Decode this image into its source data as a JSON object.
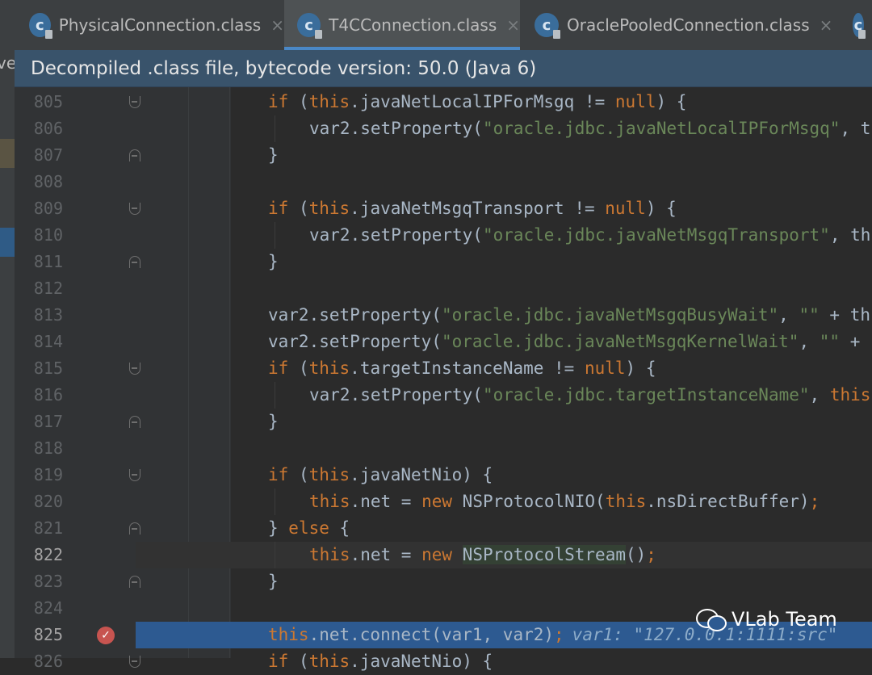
{
  "sidebar_fragment": "ve",
  "tabs": [
    {
      "label": "PhysicalConnection.class",
      "icon": "c",
      "active": false
    },
    {
      "label": "T4CConnection.class",
      "icon": "c",
      "active": true
    },
    {
      "label": "OraclePooledConnection.class",
      "icon": "c",
      "active": false
    },
    {
      "label": "",
      "icon": "c",
      "active": false
    }
  ],
  "tab_close_glyph": "×",
  "banner": "Decompiled .class file, bytecode version: 50.0 (Java 6)",
  "lines": [
    {
      "num": "805",
      "indent": 0,
      "fold": "open",
      "segs": [
        [
          "k",
          "if"
        ],
        [
          "p",
          " ("
        ],
        [
          "k",
          "this"
        ],
        [
          "p",
          ".javaNetLocalIPForMsgq != "
        ],
        [
          "k",
          "null"
        ],
        [
          "p",
          ") {"
        ]
      ]
    },
    {
      "num": "806",
      "indent": 1,
      "segs": [
        [
          "p",
          "var2.setProperty("
        ],
        [
          "s",
          "\"oracle.jdbc.javaNetLocalIPForMsgq\""
        ],
        [
          "p",
          ", t"
        ]
      ]
    },
    {
      "num": "807",
      "indent": 0,
      "fold": "close",
      "segs": [
        [
          "p",
          "}"
        ]
      ]
    },
    {
      "num": "808",
      "indent": 0,
      "segs": []
    },
    {
      "num": "809",
      "indent": 0,
      "fold": "open",
      "segs": [
        [
          "k",
          "if"
        ],
        [
          "p",
          " ("
        ],
        [
          "k",
          "this"
        ],
        [
          "p",
          ".javaNetMsgqTransport != "
        ],
        [
          "k",
          "null"
        ],
        [
          "p",
          ") {"
        ]
      ]
    },
    {
      "num": "810",
      "indent": 1,
      "segs": [
        [
          "p",
          "var2.setProperty("
        ],
        [
          "s",
          "\"oracle.jdbc.javaNetMsgqTransport\""
        ],
        [
          "p",
          ", th"
        ]
      ]
    },
    {
      "num": "811",
      "indent": 0,
      "fold": "close",
      "segs": [
        [
          "p",
          "}"
        ]
      ]
    },
    {
      "num": "812",
      "indent": 0,
      "segs": []
    },
    {
      "num": "813",
      "indent": 0,
      "segs": [
        [
          "p",
          "var2.setProperty("
        ],
        [
          "s",
          "\"oracle.jdbc.javaNetMsgqBusyWait\""
        ],
        [
          "p",
          ", "
        ],
        [
          "s",
          "\"\""
        ],
        [
          "p",
          " + th"
        ]
      ]
    },
    {
      "num": "814",
      "indent": 0,
      "segs": [
        [
          "p",
          "var2.setProperty("
        ],
        [
          "s",
          "\"oracle.jdbc.javaNetMsgqKernelWait\""
        ],
        [
          "p",
          ", "
        ],
        [
          "s",
          "\"\""
        ],
        [
          "p",
          " + "
        ]
      ]
    },
    {
      "num": "815",
      "indent": 0,
      "fold": "open",
      "segs": [
        [
          "k",
          "if"
        ],
        [
          "p",
          " ("
        ],
        [
          "k",
          "this"
        ],
        [
          "p",
          ".targetInstanceName != "
        ],
        [
          "k",
          "null"
        ],
        [
          "p",
          ") {"
        ]
      ]
    },
    {
      "num": "816",
      "indent": 1,
      "segs": [
        [
          "p",
          "var2.setProperty("
        ],
        [
          "s",
          "\"oracle.jdbc.targetInstanceName\""
        ],
        [
          "p",
          ", "
        ],
        [
          "k",
          "this"
        ]
      ]
    },
    {
      "num": "817",
      "indent": 0,
      "fold": "close",
      "segs": [
        [
          "p",
          "}"
        ]
      ]
    },
    {
      "num": "818",
      "indent": 0,
      "segs": []
    },
    {
      "num": "819",
      "indent": 0,
      "fold": "open",
      "segs": [
        [
          "k",
          "if"
        ],
        [
          "p",
          " ("
        ],
        [
          "k",
          "this"
        ],
        [
          "p",
          ".javaNetNio) {"
        ]
      ]
    },
    {
      "num": "820",
      "indent": 1,
      "segs": [
        [
          "k",
          "this"
        ],
        [
          "p",
          ".net = "
        ],
        [
          "k",
          "new"
        ],
        [
          "p",
          " NSProtocolNIO("
        ],
        [
          "k",
          "this"
        ],
        [
          "p",
          ".nsDirectBuffer)"
        ],
        [
          "k",
          ";"
        ]
      ]
    },
    {
      "num": "821",
      "indent": 0,
      "fold": "close",
      "segs": [
        [
          "p",
          "} "
        ],
        [
          "k",
          "else"
        ],
        [
          "p",
          " {"
        ]
      ]
    },
    {
      "num": "822",
      "indent": 1,
      "current": true,
      "segs": [
        [
          "k",
          "this"
        ],
        [
          "p",
          ".net = "
        ],
        [
          "k",
          "new"
        ],
        [
          "p",
          " "
        ],
        [
          "hl",
          "NSProtocolStream"
        ],
        [
          "p",
          "()"
        ],
        [
          "k",
          ";"
        ]
      ]
    },
    {
      "num": "823",
      "indent": 0,
      "fold": "close",
      "segs": [
        [
          "p",
          "}"
        ]
      ]
    },
    {
      "num": "824",
      "indent": 0,
      "segs": []
    },
    {
      "num": "825",
      "indent": 0,
      "exec": true,
      "breakpoint": true,
      "segs": [
        [
          "k",
          "this"
        ],
        [
          "p",
          ".net.connect(var1, var2)"
        ],
        [
          "k",
          ";"
        ]
      ],
      "inline_value": "var1: \"127.0.0.1:1111:src\""
    },
    {
      "num": "826",
      "indent": 0,
      "fold": "open",
      "segs": [
        [
          "k",
          "if"
        ],
        [
          "p",
          " ("
        ],
        [
          "k",
          "this"
        ],
        [
          "p",
          ".javaNetNio) {"
        ]
      ]
    }
  ],
  "watermark": "VLab Team",
  "colors": {
    "keyword": "#cc7832",
    "string": "#6a8759",
    "plain": "#a9b7c6",
    "exec_line": "#2d5a91",
    "banner": "#39536b"
  }
}
